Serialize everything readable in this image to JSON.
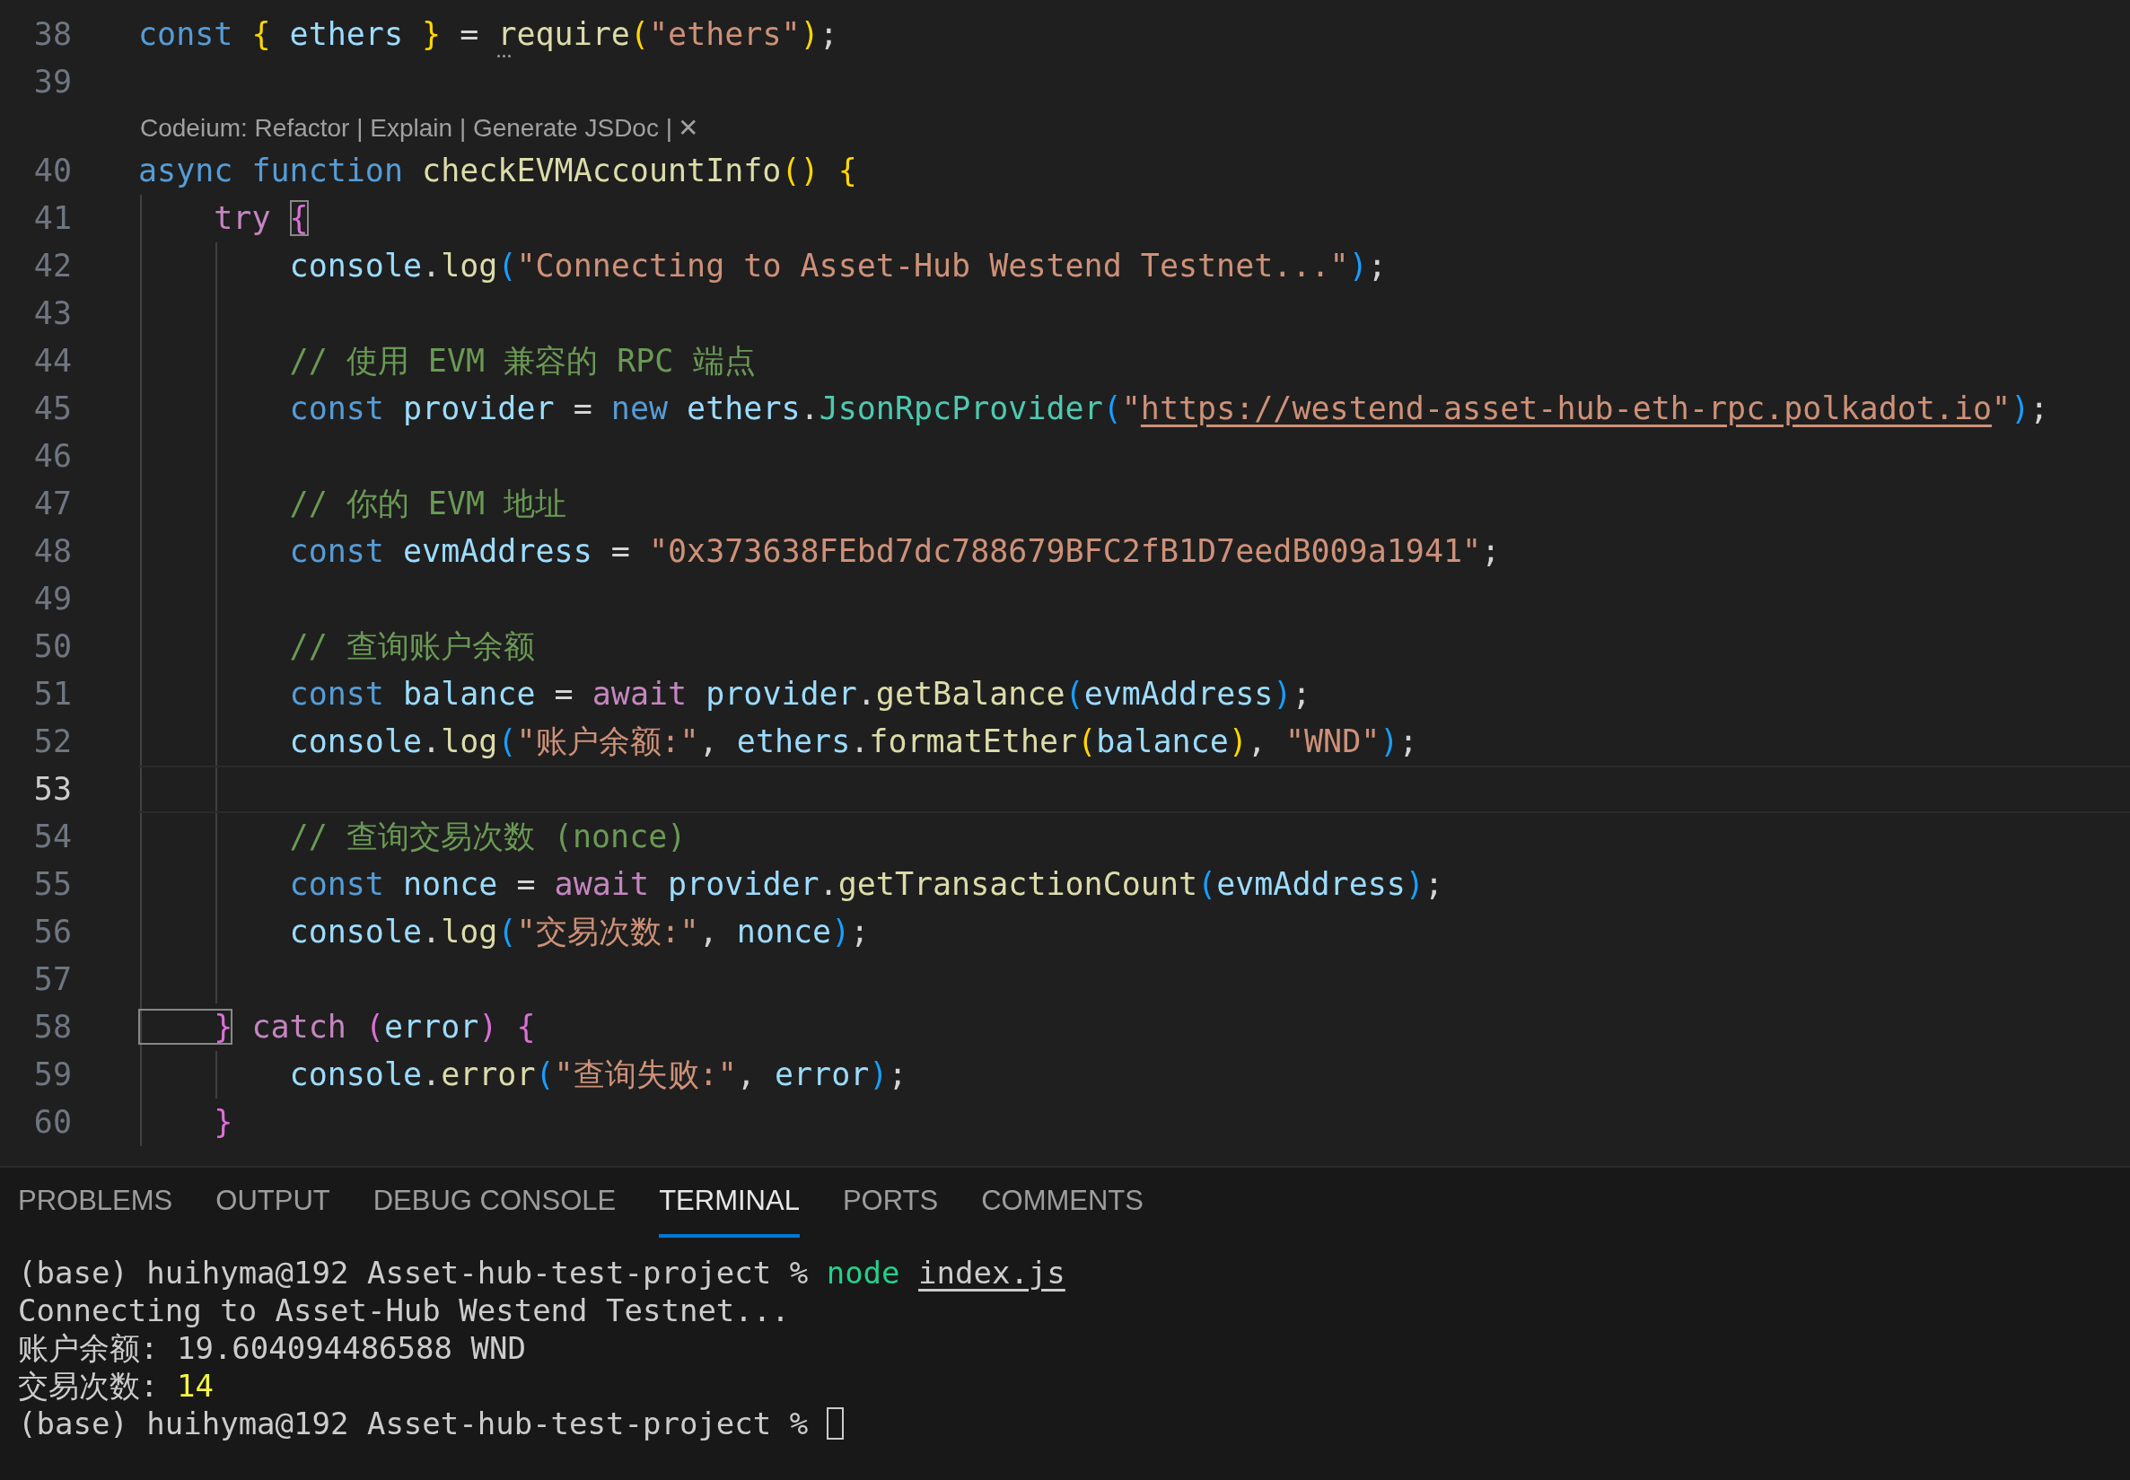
{
  "editor": {
    "lines": [
      {
        "number": "38",
        "current": false,
        "tokens": [
          {
            "t": "const ",
            "kind": "kw"
          },
          {
            "t": "{",
            "kind": "b1"
          },
          {
            "t": " ethers ",
            "kind": "var"
          },
          {
            "t": "}",
            "kind": "b1"
          },
          {
            "t": " = ",
            "kind": "p"
          },
          {
            "t": "require",
            "kind": "fn",
            "dots": true
          },
          {
            "t": "(",
            "kind": "b1"
          },
          {
            "t": "\"ethers\"",
            "kind": "str"
          },
          {
            "t": ")",
            "kind": "b1"
          },
          {
            "t": ";",
            "kind": "p"
          }
        ]
      },
      {
        "number": "39",
        "current": false
      },
      {
        "kind": "codelens",
        "text": "Codeium: Refactor | Explain | Generate JSDoc |",
        "close": "✕"
      },
      {
        "number": "40",
        "current": false,
        "tokens": [
          {
            "t": "async function ",
            "kind": "kw"
          },
          {
            "t": "checkEVMAccountInfo",
            "kind": "fn"
          },
          {
            "t": "()",
            "kind": "b1"
          },
          {
            "t": " {",
            "kind": "b1"
          }
        ]
      },
      {
        "number": "41",
        "current": false,
        "tokens": [
          {
            "t": "    try ",
            "kind": "ctl"
          },
          {
            "t": "{",
            "kind": "b2",
            "matched": true
          }
        ]
      },
      {
        "number": "42",
        "current": false,
        "tokens": [
          {
            "t": "        console",
            "kind": "var"
          },
          {
            "t": ".",
            "kind": "p"
          },
          {
            "t": "log",
            "kind": "fn"
          },
          {
            "t": "(",
            "kind": "b3"
          },
          {
            "t": "\"Connecting to Asset-Hub Westend Testnet...\"",
            "kind": "str"
          },
          {
            "t": ")",
            "kind": "b3"
          },
          {
            "t": ";",
            "kind": "p"
          }
        ]
      },
      {
        "number": "43",
        "current": false
      },
      {
        "number": "44",
        "current": false,
        "tokens": [
          {
            "t": "        // 使用 EVM 兼容的 RPC 端点",
            "kind": "cmt"
          }
        ]
      },
      {
        "number": "45",
        "current": false,
        "tokens": [
          {
            "t": "        const ",
            "kind": "kw"
          },
          {
            "t": "provider",
            "kind": "var"
          },
          {
            "t": " = ",
            "kind": "p"
          },
          {
            "t": "new ",
            "kind": "kw"
          },
          {
            "t": "ethers",
            "kind": "var"
          },
          {
            "t": ".",
            "kind": "p"
          },
          {
            "t": "JsonRpcProvider",
            "kind": "cls"
          },
          {
            "t": "(",
            "kind": "b3"
          },
          {
            "t": "\"",
            "kind": "str"
          },
          {
            "t": "https://westend-asset-hub-eth-rpc.polkadot.io",
            "kind": "link"
          },
          {
            "t": "\"",
            "kind": "str"
          },
          {
            "t": ")",
            "kind": "b3"
          },
          {
            "t": ";",
            "kind": "p"
          }
        ]
      },
      {
        "number": "46",
        "current": false
      },
      {
        "number": "47",
        "current": false,
        "tokens": [
          {
            "t": "        // 你的 EVM 地址",
            "kind": "cmt"
          }
        ]
      },
      {
        "number": "48",
        "current": false,
        "tokens": [
          {
            "t": "        const ",
            "kind": "kw"
          },
          {
            "t": "evmAddress",
            "kind": "var"
          },
          {
            "t": " = ",
            "kind": "p"
          },
          {
            "t": "\"0x373638FEbd7dc788679BFC2fB1D7eedB009a1941\"",
            "kind": "str"
          },
          {
            "t": ";",
            "kind": "p"
          }
        ]
      },
      {
        "number": "49",
        "current": false
      },
      {
        "number": "50",
        "current": false,
        "tokens": [
          {
            "t": "        // 查询账户余额",
            "kind": "cmt"
          }
        ]
      },
      {
        "number": "51",
        "current": false,
        "tokens": [
          {
            "t": "        const ",
            "kind": "kw"
          },
          {
            "t": "balance",
            "kind": "var"
          },
          {
            "t": " = ",
            "kind": "p"
          },
          {
            "t": "await ",
            "kind": "ctl"
          },
          {
            "t": "provider",
            "kind": "var"
          },
          {
            "t": ".",
            "kind": "p"
          },
          {
            "t": "getBalance",
            "kind": "fn"
          },
          {
            "t": "(",
            "kind": "b3"
          },
          {
            "t": "evmAddress",
            "kind": "var"
          },
          {
            "t": ")",
            "kind": "b3"
          },
          {
            "t": ";",
            "kind": "p"
          }
        ]
      },
      {
        "number": "52",
        "current": false,
        "tokens": [
          {
            "t": "        console",
            "kind": "var"
          },
          {
            "t": ".",
            "kind": "p"
          },
          {
            "t": "log",
            "kind": "fn"
          },
          {
            "t": "(",
            "kind": "b3"
          },
          {
            "t": "\"账户余额:\"",
            "kind": "str"
          },
          {
            "t": ", ",
            "kind": "p"
          },
          {
            "t": "ethers",
            "kind": "var"
          },
          {
            "t": ".",
            "kind": "p"
          },
          {
            "t": "formatEther",
            "kind": "fn"
          },
          {
            "t": "(",
            "kind": "b1"
          },
          {
            "t": "balance",
            "kind": "var"
          },
          {
            "t": ")",
            "kind": "b1"
          },
          {
            "t": ", ",
            "kind": "p"
          },
          {
            "t": "\"WND\"",
            "kind": "str"
          },
          {
            "t": ")",
            "kind": "b3"
          },
          {
            "t": ";",
            "kind": "p"
          }
        ]
      },
      {
        "number": "53",
        "current": true
      },
      {
        "number": "54",
        "current": false,
        "tokens": [
          {
            "t": "        // 查询交易次数 (nonce)",
            "kind": "cmt"
          }
        ]
      },
      {
        "number": "55",
        "current": false,
        "tokens": [
          {
            "t": "        const ",
            "kind": "kw"
          },
          {
            "t": "nonce",
            "kind": "var"
          },
          {
            "t": " = ",
            "kind": "p"
          },
          {
            "t": "await ",
            "kind": "ctl"
          },
          {
            "t": "provider",
            "kind": "var"
          },
          {
            "t": ".",
            "kind": "p"
          },
          {
            "t": "getTransactionCount",
            "kind": "fn"
          },
          {
            "t": "(",
            "kind": "b3"
          },
          {
            "t": "evmAddress",
            "kind": "var"
          },
          {
            "t": ")",
            "kind": "b3"
          },
          {
            "t": ";",
            "kind": "p"
          }
        ]
      },
      {
        "number": "56",
        "current": false,
        "tokens": [
          {
            "t": "        console",
            "kind": "var"
          },
          {
            "t": ".",
            "kind": "p"
          },
          {
            "t": "log",
            "kind": "fn"
          },
          {
            "t": "(",
            "kind": "b3"
          },
          {
            "t": "\"交易次数:\"",
            "kind": "str"
          },
          {
            "t": ", ",
            "kind": "p"
          },
          {
            "t": "nonce",
            "kind": "var"
          },
          {
            "t": ")",
            "kind": "b3"
          },
          {
            "t": ";",
            "kind": "p"
          }
        ]
      },
      {
        "number": "57",
        "current": false
      },
      {
        "number": "58",
        "current": false,
        "tokens": [
          {
            "t": "    }",
            "kind": "b2",
            "matched": true
          },
          {
            "t": " catch ",
            "kind": "ctl"
          },
          {
            "t": "(",
            "kind": "b2"
          },
          {
            "t": "error",
            "kind": "var"
          },
          {
            "t": ")",
            "kind": "b2"
          },
          {
            "t": " {",
            "kind": "b2"
          }
        ]
      },
      {
        "number": "59",
        "current": false,
        "tokens": [
          {
            "t": "        console",
            "kind": "var"
          },
          {
            "t": ".",
            "kind": "p"
          },
          {
            "t": "error",
            "kind": "fn"
          },
          {
            "t": "(",
            "kind": "b3"
          },
          {
            "t": "\"查询失败:\"",
            "kind": "str"
          },
          {
            "t": ", ",
            "kind": "p"
          },
          {
            "t": "error",
            "kind": "var"
          },
          {
            "t": ")",
            "kind": "b3"
          },
          {
            "t": ";",
            "kind": "p"
          }
        ]
      },
      {
        "number": "60",
        "current": false,
        "tokens": [
          {
            "t": "    }",
            "kind": "b2"
          }
        ]
      }
    ]
  },
  "panel": {
    "tabs": [
      {
        "label": "PROBLEMS",
        "selected": false
      },
      {
        "label": "OUTPUT",
        "selected": false
      },
      {
        "label": "DEBUG CONSOLE",
        "selected": false
      },
      {
        "label": "TERMINAL",
        "selected": true
      },
      {
        "label": "PORTS",
        "selected": false
      },
      {
        "label": "COMMENTS",
        "selected": false
      }
    ],
    "terminal": [
      {
        "tokens": [
          {
            "t": "(base) huihyma@192 Asset-hub-test-project % ",
            "kind": "p"
          },
          {
            "t": "node ",
            "kind": "cmd"
          },
          {
            "t": "index.js",
            "kind": "path"
          }
        ]
      },
      {
        "tokens": [
          {
            "t": "Connecting to Asset-Hub Westend Testnet...",
            "kind": "p"
          }
        ]
      },
      {
        "tokens": [
          {
            "t": "账户余额: 19.604094486588 WND",
            "kind": "p"
          }
        ]
      },
      {
        "tokens": [
          {
            "t": "交易次数: ",
            "kind": "p"
          },
          {
            "t": "14",
            "kind": "num"
          }
        ]
      },
      {
        "cursor": true,
        "tokens": [
          {
            "t": "(base) huihyma@192 Asset-hub-test-project % ",
            "kind": "p"
          }
        ]
      }
    ]
  }
}
